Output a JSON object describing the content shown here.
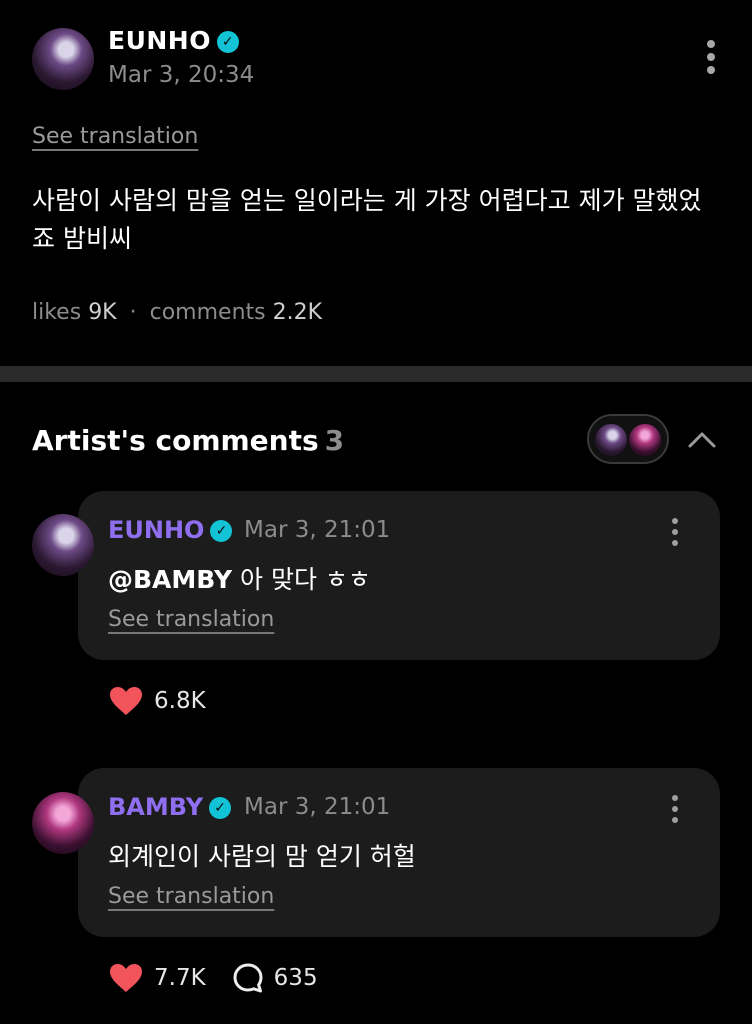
{
  "post": {
    "author": "EUNHO",
    "timestamp": "Mar 3, 20:34",
    "see_translation": "See translation",
    "body": "사람이 사람의 맘을 얻는 일이라는 게 가장 어렵다고 제가 말했었죠 밤비씨",
    "stats": {
      "likes_label": "likes",
      "likes_value": "9K",
      "separator": "·",
      "comments_label": "comments",
      "comments_value": "2.2K"
    }
  },
  "artist_comments": {
    "title": "Artist's comments",
    "count": "3",
    "comments": [
      {
        "author": "EUNHO",
        "timestamp": "Mar 3, 21:01",
        "mention": "@BAMBY",
        "text": " 아 맞다 ㅎㅎ",
        "see_translation": "See translation",
        "likes": "6.8K"
      },
      {
        "author": "BAMBY",
        "timestamp": "Mar 3, 21:01",
        "text": "외계인이 사람의 맘 얻기 허헐",
        "see_translation": "See translation",
        "likes": "7.7K",
        "replies": "635"
      }
    ]
  },
  "colors": {
    "background": "#000000",
    "card": "#1c1c1c",
    "artist_name": "#8f6ff0",
    "verified": "#12c3d6",
    "heart": "#f2545b",
    "muted": "#8c8c8c"
  },
  "icons": [
    "verified-badge-icon",
    "more-vertical-icon",
    "chevron-up-icon",
    "heart-icon",
    "reply-bubble-icon"
  ]
}
